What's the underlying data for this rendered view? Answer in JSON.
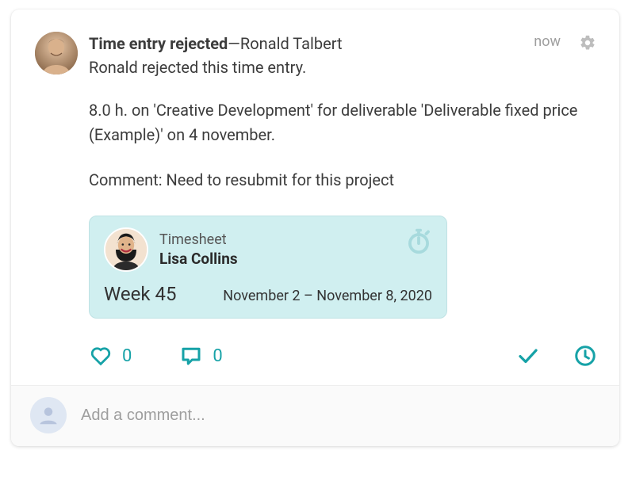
{
  "post": {
    "title": "Time entry rejected",
    "title_sep": "—",
    "author": "Ronald Talbert",
    "timestamp": "now",
    "subtitle": "Ronald rejected this time entry.",
    "body": "8.0 h. on 'Creative Development' for deliverable 'Deliverable fixed price (Example)' on 4 november.",
    "comment_label": "Comment: ",
    "comment_text": "Need to resubmit for this project"
  },
  "timesheet": {
    "type_label": "Timesheet",
    "person": "Lisa Collins",
    "week_label": "Week 45",
    "date_range": "November 2 – November 8, 2020"
  },
  "actions": {
    "like_count": "0",
    "comment_count": "0"
  },
  "comment_bar": {
    "placeholder": "Add a comment..."
  },
  "colors": {
    "accent": "#16a2a7",
    "timesheet_bg": "#d0eff0"
  }
}
